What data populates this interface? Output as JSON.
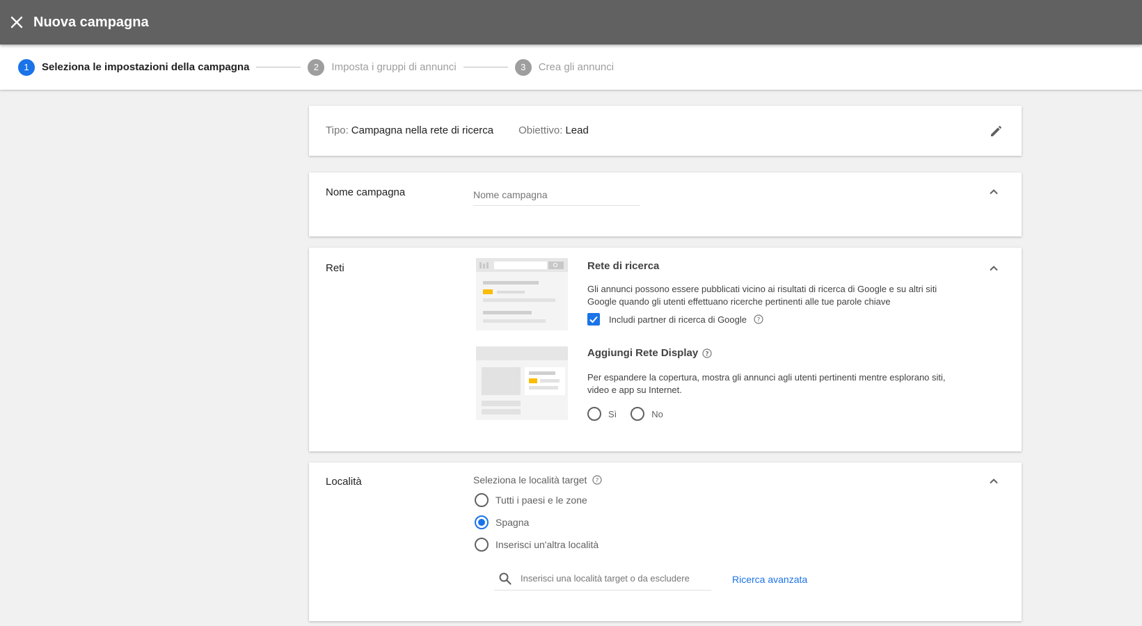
{
  "header": {
    "title": "Nuova campagna",
    "close_icon": "close-icon"
  },
  "stepper": {
    "steps": [
      {
        "number": "1",
        "label": "Seleziona le impostazioni della campagna",
        "state": "active"
      },
      {
        "number": "2",
        "label": "Imposta i gruppi di annunci",
        "state": "inactive"
      },
      {
        "number": "3",
        "label": "Crea gli annunci",
        "state": "inactive"
      }
    ]
  },
  "type_card": {
    "type_key": "Tipo:",
    "type_value": "Campagna nella rete di ricerca",
    "goal_key": "Obiettivo:",
    "goal_value": "Lead",
    "edit_icon": "pencil-icon"
  },
  "name_card": {
    "label": "Nome campagna",
    "input_placeholder": "Nome campagna",
    "input_value": ""
  },
  "networks_card": {
    "label": "Reti",
    "search_network": {
      "title": "Rete di ricerca",
      "description": "Gli annunci possono essere pubblicati vicino ai risultati di ricerca di Google e su altri siti Google quando gli utenti effettuano ricerche pertinenti alle tue parole chiave",
      "checkbox_label": "Includi partner di ricerca di Google",
      "checkbox_checked": true
    },
    "display_network": {
      "title": "Aggiungi Rete Display",
      "description": "Per espandere la copertura, mostra gli annunci agli utenti pertinenti mentre esplorano siti, video e app su Internet.",
      "option_yes": "Sì",
      "option_no": "No"
    }
  },
  "location_card": {
    "label": "Località",
    "heading": "Seleziona le località target",
    "options": [
      {
        "label": "Tutti i paesi e le zone",
        "selected": false
      },
      {
        "label": "Spagna",
        "selected": true
      },
      {
        "label": "Inserisci un'altra località",
        "selected": false
      }
    ],
    "search_placeholder": "Inserisci una località target o da escludere",
    "advanced_link": "Ricerca avanzata"
  },
  "colors": {
    "accent": "#1a73e8",
    "header_bg": "#616161",
    "page_bg": "#f1f1f1",
    "highlight": "#fbbc04"
  }
}
